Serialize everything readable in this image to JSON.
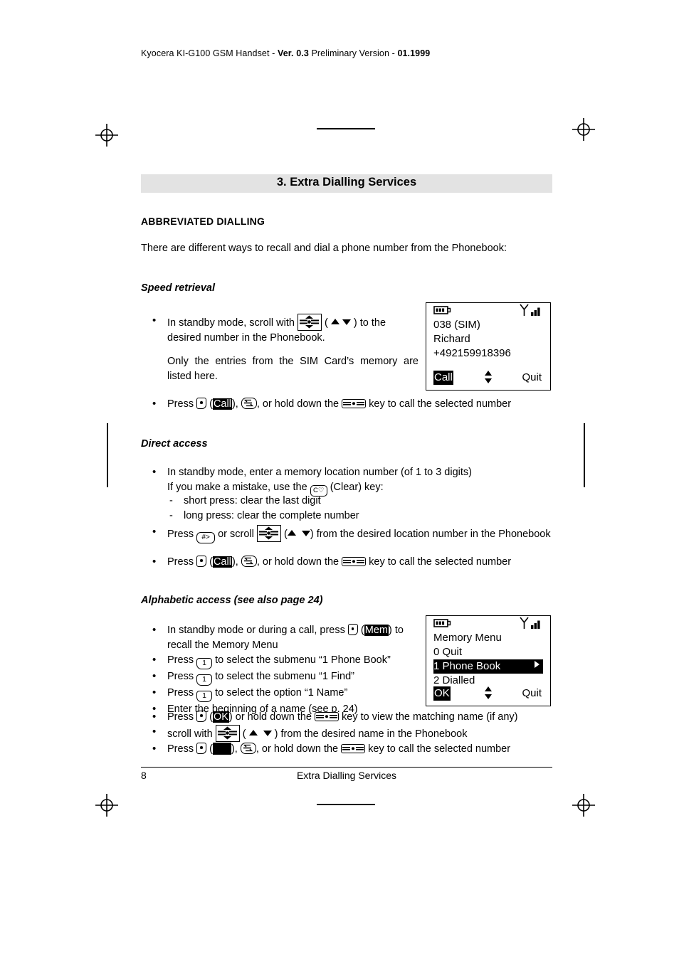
{
  "running_head": {
    "pre": "Kyocera KI-G100 GSM Handset - ",
    "bold1": "Ver. 0.3",
    "mid": " Preliminary Version - ",
    "bold2": "01.1999"
  },
  "chapter": {
    "title": "3. Extra Dialling Services",
    "bar_color": "#e3e3e3"
  },
  "section": {
    "heading": "ABBREVIATED DIALLING",
    "intro": "There are different ways to recall and dial a phone number from the Phonebook:"
  },
  "speed_retrieval": {
    "heading": "Speed retrieval",
    "b1_pre": "In standby mode, scroll with ",
    "b1_mid": " ( ",
    "b1_mid2": "  ",
    "b1_post": " ) to the desired number in the Phonebook.",
    "note": "Only the entries from the SIM Card’s memory are listed here.",
    "b2_pre": "Press ",
    "b2_softlabel": "Call",
    "b2_mid": "), ",
    "b2_mid2": ", or hold down the ",
    "b2_post": " key to call the selected number"
  },
  "direct_access": {
    "heading": "Direct access",
    "b1_line1": "In standby mode, enter a memory location number (of 1 to 3 digits)",
    "b1_line2_pre": "If you make a mistake, use the ",
    "b1_line2_post": " (Clear) key:",
    "d1": "short press: clear the last digit",
    "d2": "long press: clear the complete number",
    "b2_pre": "Press ",
    "b2_mid": " or scroll ",
    "b2_post": " from the desired location number in the Phonebook",
    "b3_pre": "Press ",
    "b3_softlabel": "Call",
    "b3_mid": "), ",
    "b3_mid2": ", or hold down the ",
    "b3_post": " key to call the selected number"
  },
  "alphabetic_access": {
    "heading": "Alphabetic access (see also page 24)",
    "b1_pre": "In standby mode or during a call, press ",
    "b1_softlabel": "Mem",
    "b1_post": ") to recall the Memory Menu",
    "b2_pre": "Press ",
    "b2_post": " to select the submenu “1 Phone Book”",
    "b3_pre": "Press ",
    "b3_post": " to select the submenu “1 Find”",
    "b4_pre": "Press ",
    "b4_post": " to select the option “1 Name”",
    "b5": "Enter the beginning of a name (see p. 24)",
    "b6_pre": "Press ",
    "b6_softlabel": "OK",
    "b6_mid": ") or hold down the ",
    "b6_post": " key to view the matching name (if any)",
    "b7_pre": "scroll with ",
    "b7_mid": " ( ",
    "b7_post": " ) from the desired name in the Phonebook",
    "b8_pre": "Press ",
    "b8_mid": "), ",
    "b8_mid2": ", or hold down the ",
    "b8_post": " key to call the selected number",
    "key_1": "1"
  },
  "keys": {
    "clear_label": "C",
    "hash_label": "#>"
  },
  "lcd_speed": {
    "line1": "038 (SIM)",
    "line2": "Richard",
    "line3": "+492159918396",
    "softkey_left": "Call",
    "softkey_right": "Quit"
  },
  "lcd_memory": {
    "line1": "Memory Menu",
    "line2": "0 Quit",
    "line3_highlight": "1 Phone Book",
    "line4": "2 Dialled",
    "softkey_left": "OK",
    "softkey_right": "Quit"
  },
  "footer": {
    "page_number": "8",
    "title": "Extra Dialling Services"
  }
}
